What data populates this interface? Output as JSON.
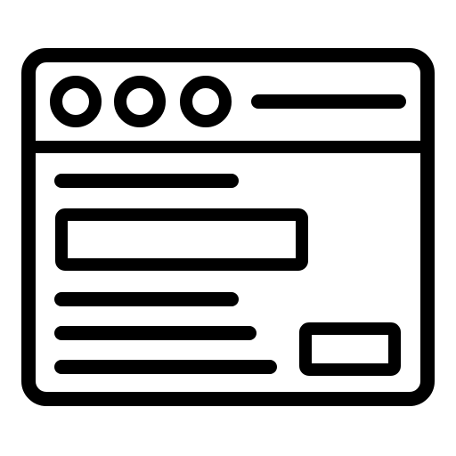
{
  "icon": {
    "name": "browser-window-form-icon",
    "style": "outline",
    "stroke_color": "#000000",
    "background_color": "#ffffff",
    "window_control_dots": 3,
    "content_text_lines": 4,
    "input_fields": 1,
    "action_buttons": 1
  }
}
